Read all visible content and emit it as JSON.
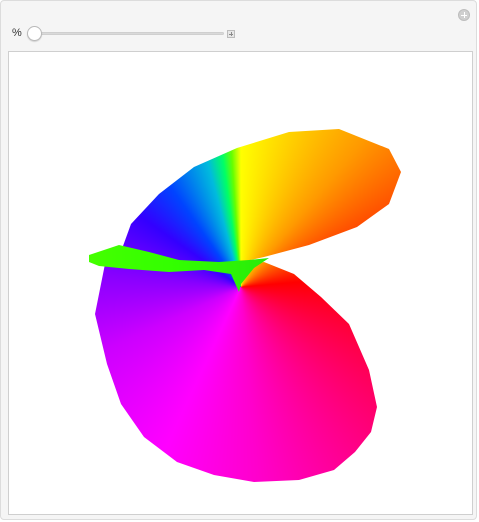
{
  "panel": {
    "slider": {
      "label": "%",
      "value": 0
    }
  },
  "colors": {
    "panel_bg": "#f5f5f5",
    "canvas_bg": "#ffffff",
    "track": "#d9d9d9"
  },
  "icons": {
    "corner": "add-circle-icon",
    "expand": "plus-box-icon"
  }
}
